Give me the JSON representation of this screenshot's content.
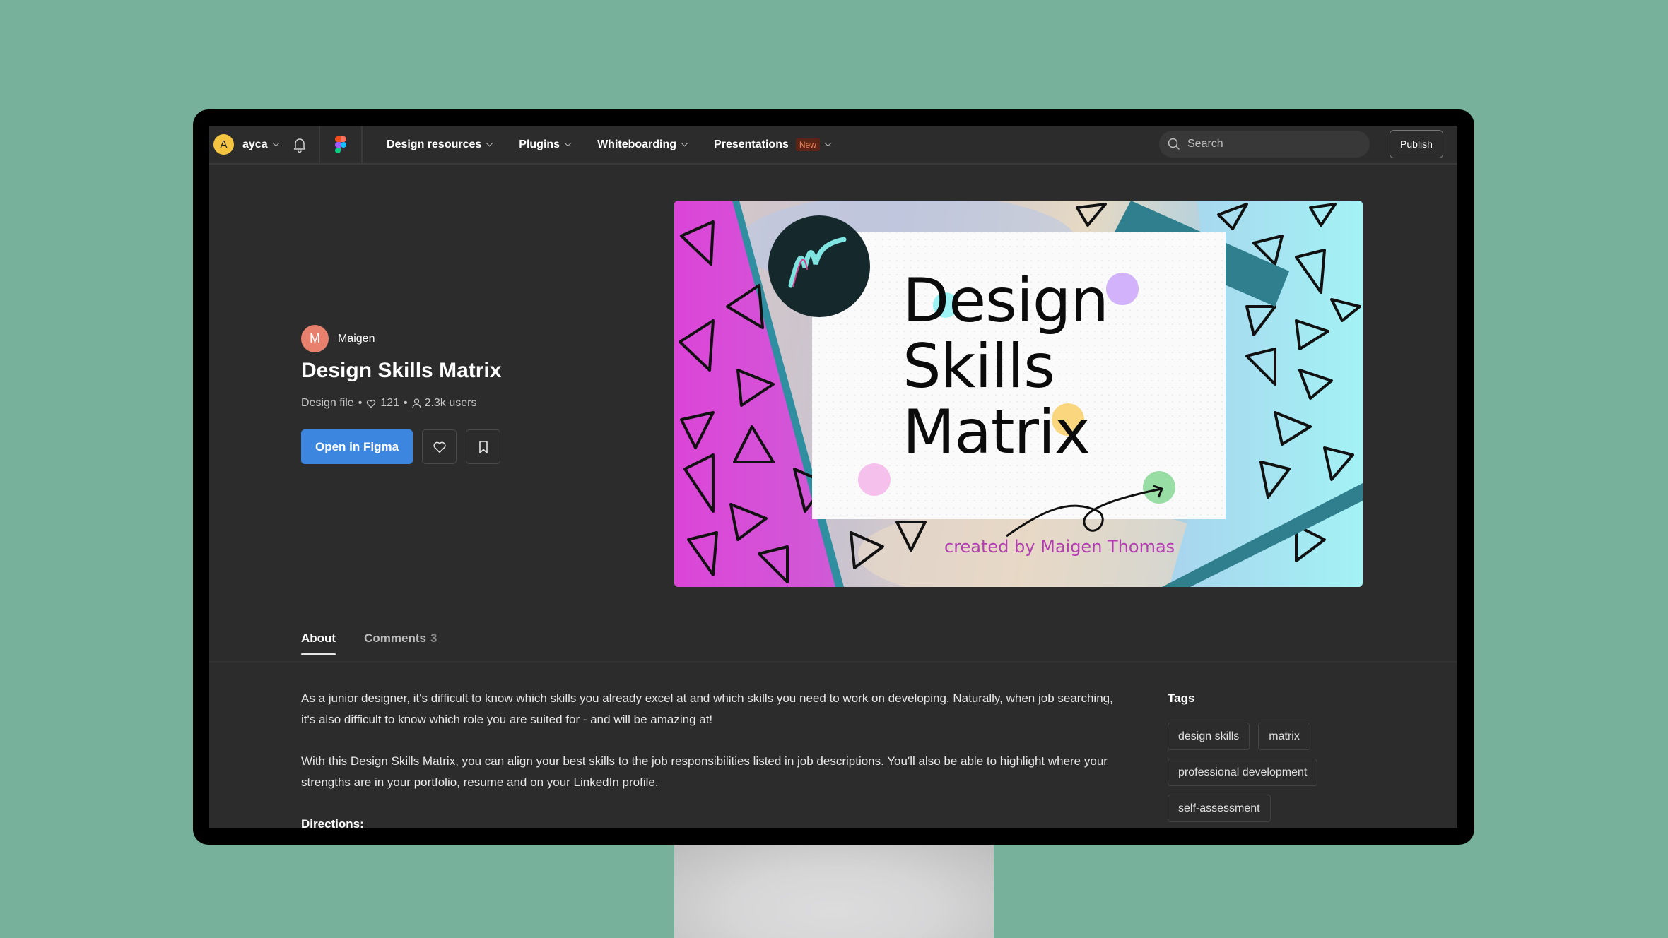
{
  "colors": {
    "background": "#77b09b",
    "screen_bg": "#2c2c2c",
    "primary_button": "#3d86e0",
    "user_avatar": "#f5c542",
    "author_avatar": "#e8806e",
    "new_badge_bg": "#5a2416",
    "new_badge_text": "#f08a5d"
  },
  "nav": {
    "user": {
      "initial": "A",
      "name": "ayca"
    },
    "icons": {
      "notifications": "bell-icon",
      "logo": "figma-logo"
    },
    "menu": [
      {
        "label": "Design resources",
        "badge": null
      },
      {
        "label": "Plugins",
        "badge": null
      },
      {
        "label": "Whiteboarding",
        "badge": null
      },
      {
        "label": "Presentations",
        "badge": "New"
      }
    ],
    "search": {
      "placeholder": "Search"
    },
    "publish_label": "Publish"
  },
  "file": {
    "author": {
      "initial": "M",
      "name": "Maigen"
    },
    "title": "Design Skills Matrix",
    "type": "Design file",
    "likes": "121",
    "users": "2.3k users",
    "open_label": "Open in Figma",
    "like_icon": "heart-icon",
    "bookmark_icon": "bookmark-icon"
  },
  "cover": {
    "heading_lines": [
      "Design",
      "Skills",
      "Matrix"
    ],
    "credit": "created by Maigen Thomas",
    "logo_glyph": "m"
  },
  "tabs": [
    {
      "label": "About",
      "count": null,
      "active": true
    },
    {
      "label": "Comments",
      "count": "3",
      "active": false
    }
  ],
  "about": {
    "paragraphs": [
      "As a junior designer, it's difficult to know which skills you already excel at and which skills you need to work on developing. Naturally, when job searching, it's also difficult to know which role you are suited for - and will be amazing at!",
      "With this Design Skills Matrix, you can align your best skills to the job responsibilities listed in job descriptions. You'll also be able to highlight where your strengths are in your portfolio, resume and on your LinkedIn profile."
    ],
    "directions_heading": "Directions:"
  },
  "tags": {
    "title": "Tags",
    "items": [
      "design skills",
      "matrix",
      "professional development",
      "self-assessment"
    ]
  }
}
